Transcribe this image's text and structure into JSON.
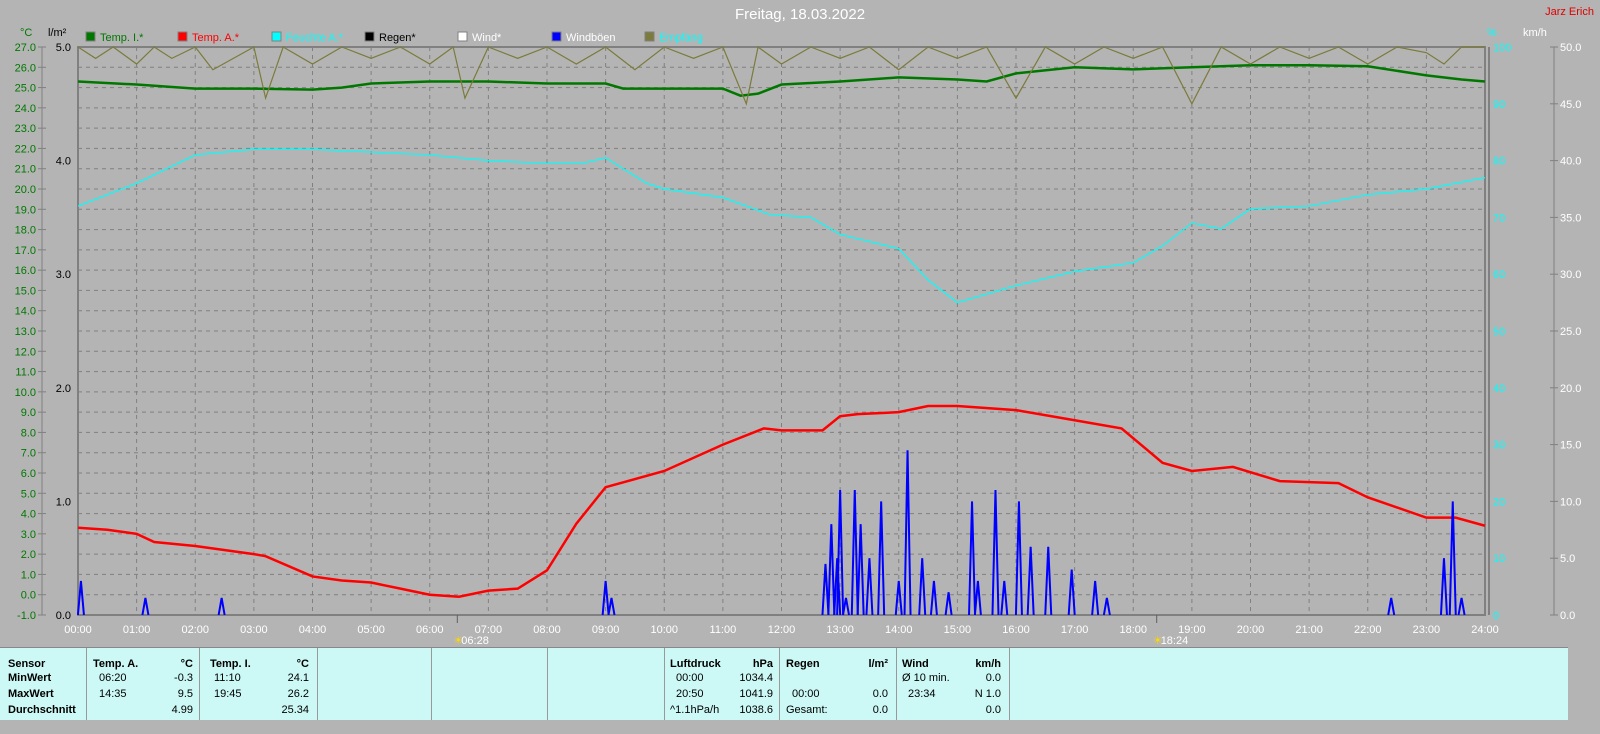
{
  "header": {
    "title": "Freitag, 18.03.2022",
    "author": "Jarz Erich"
  },
  "chart_data": {
    "type": "line",
    "title": "Freitag, 18.03.2022",
    "legend_placement": "top",
    "legend": [
      {
        "label": "Temp. I.*",
        "color": "#007800",
        "text_color": "#007800"
      },
      {
        "label": "Temp. A.*",
        "color": "#ff0000",
        "text_color": "#ff0000"
      },
      {
        "label": "Feuchte A.*",
        "color": "#00ffff",
        "text_color": "#00ffff"
      },
      {
        "label": "Regen*",
        "color": "#000000",
        "text_color": "#000000"
      },
      {
        "label": "Wind*",
        "color": "#ffffff",
        "text_color": "#ffffff"
      },
      {
        "label": "Windböen",
        "color": "#0000ff",
        "text_color": "#ffffff"
      },
      {
        "label": "Empfang",
        "color": "#7b7b3b",
        "text_color": "#00ffff"
      }
    ],
    "axes": {
      "temp": {
        "unit": "°C",
        "range": [
          -1.0,
          27.0
        ],
        "ticks": [
          "27.0",
          "26.0",
          "25.0",
          "24.0",
          "23.0",
          "22.0",
          "21.0",
          "20.0",
          "19.0",
          "18.0",
          "17.0",
          "16.0",
          "15.0",
          "14.0",
          "13.0",
          "12.0",
          "11.0",
          "10.0",
          "9.0",
          "8.0",
          "7.0",
          "6.0",
          "5.0",
          "4.0",
          "3.0",
          "2.0",
          "1.0",
          "0.0",
          "-1.0"
        ],
        "color": "#007800"
      },
      "rain": {
        "unit": "l/m²",
        "range": [
          0,
          5
        ],
        "ticks": [
          "5.0",
          "4.0",
          "3.0",
          "2.0",
          "1.0",
          "0.0"
        ],
        "color": "#000000"
      },
      "humidity": {
        "unit": "%",
        "range": [
          0,
          100
        ],
        "ticks": [
          "100",
          "90",
          "80",
          "70",
          "60",
          "50",
          "40",
          "30",
          "20",
          "10",
          "0"
        ],
        "color": "#00ffff"
      },
      "wind": {
        "unit": "km/h",
        "range": [
          0,
          50
        ],
        "ticks": [
          "50.0",
          "45.0",
          "40.0",
          "35.0",
          "30.0",
          "25.0",
          "20.0",
          "15.0",
          "10.0",
          "5.0",
          "0.0"
        ],
        "color": "#ffffff"
      },
      "x": {
        "range": [
          0,
          24
        ],
        "ticks": [
          "00:00",
          "01:00",
          "02:00",
          "03:00",
          "04:00",
          "05:00",
          "06:00",
          "07:00",
          "08:00",
          "09:00",
          "10:00",
          "11:00",
          "12:00",
          "13:00",
          "14:00",
          "15:00",
          "16:00",
          "17:00",
          "18:00",
          "19:00",
          "20:00",
          "21:00",
          "22:00",
          "23:00",
          "24:00"
        ]
      }
    },
    "sunrise": {
      "hour": 6.47,
      "label": "06:28"
    },
    "sunset": {
      "hour": 18.4,
      "label": "18:24"
    },
    "series": [
      {
        "name": "Temp. I.",
        "axis": "temp",
        "color": "#007800",
        "x": [
          0,
          1,
          2,
          3,
          4,
          4.5,
          5,
          6,
          7,
          8,
          9,
          9.3,
          10,
          11,
          11.3,
          11.6,
          12,
          13,
          14,
          15,
          15.5,
          16,
          17,
          18,
          19,
          20,
          21,
          22,
          23,
          23.6,
          24
        ],
        "y": [
          25.3,
          25.15,
          24.95,
          24.95,
          24.9,
          25.0,
          25.2,
          25.3,
          25.3,
          25.2,
          25.2,
          24.95,
          24.95,
          24.95,
          24.6,
          24.7,
          25.15,
          25.3,
          25.5,
          25.4,
          25.3,
          25.7,
          26.0,
          25.9,
          26.0,
          26.1,
          26.1,
          26.05,
          25.6,
          25.4,
          25.3
        ]
      },
      {
        "name": "Temp. A.",
        "axis": "temp",
        "color": "#ff0000",
        "x": [
          0,
          0.5,
          1,
          1.3,
          2,
          3,
          3.2,
          4,
          4.5,
          5,
          5.5,
          6,
          6.5,
          7,
          7.5,
          8,
          8.5,
          9,
          10,
          11,
          11.7,
          12,
          12.7,
          13,
          13.3,
          14,
          14.5,
          15,
          16,
          17,
          17.8,
          18.5,
          19,
          19.7,
          20.5,
          21.5,
          22,
          23,
          23.5,
          24
        ],
        "y": [
          3.3,
          3.2,
          3.0,
          2.6,
          2.4,
          2.0,
          1.9,
          0.9,
          0.7,
          0.6,
          0.3,
          0.0,
          -0.1,
          0.2,
          0.3,
          1.2,
          3.5,
          5.3,
          6.1,
          7.4,
          8.2,
          8.1,
          8.1,
          8.8,
          8.9,
          9.0,
          9.3,
          9.3,
          9.1,
          8.6,
          8.2,
          6.5,
          6.1,
          6.3,
          5.6,
          5.5,
          4.8,
          3.8,
          3.8,
          3.4
        ]
      },
      {
        "name": "Feuchte A.",
        "axis": "humidity",
        "color": "#00ffff",
        "x": [
          0,
          1,
          2,
          3,
          4,
          5,
          6,
          7,
          8,
          8.6,
          9,
          9.7,
          10,
          11,
          11.8,
          12.5,
          13,
          14,
          14.5,
          15,
          16,
          17,
          18,
          18.5,
          19,
          19.5,
          20,
          21,
          22,
          23,
          24
        ],
        "y": [
          72,
          76,
          81,
          82,
          82,
          81.5,
          81,
          80,
          79.5,
          79.5,
          80.5,
          76,
          75,
          73.5,
          70.5,
          70,
          67,
          64.5,
          59,
          55,
          58,
          60.5,
          62,
          65,
          69,
          68,
          71.5,
          72,
          74,
          75,
          77
        ]
      },
      {
        "name": "Empfang",
        "axis": "humidity",
        "color": "#7b7b3b",
        "x": [
          0,
          0.3,
          0.6,
          1,
          1.3,
          1.6,
          2,
          2.3,
          3,
          3.2,
          3.5,
          4,
          4.5,
          5,
          5.5,
          6,
          6.4,
          6.6,
          7,
          7.5,
          8,
          8.5,
          9,
          9.5,
          10,
          10.5,
          11,
          11.4,
          11.6,
          12,
          12.5,
          13,
          13.5,
          14,
          14.5,
          15,
          15.5,
          16,
          16.5,
          17,
          17.5,
          18,
          18.5,
          19,
          19.5,
          20,
          20.5,
          21,
          21.5,
          22,
          22.5,
          23,
          23.3,
          23.6,
          24
        ],
        "y": [
          100,
          98,
          100,
          97,
          100,
          98,
          100,
          96,
          100,
          91,
          100,
          97,
          100,
          98,
          100,
          97,
          100,
          91,
          100,
          98,
          100,
          97,
          100,
          96,
          100,
          98,
          100,
          90,
          100,
          97,
          100,
          98,
          100,
          96,
          100,
          98,
          100,
          91,
          100,
          97,
          100,
          98,
          100,
          90,
          100,
          97,
          100,
          98,
          100,
          97,
          100,
          99,
          97,
          100,
          100
        ]
      },
      {
        "name": "Windböen",
        "axis": "wind",
        "color": "#0000ff",
        "type": "spikes",
        "x": [
          0.05,
          1.15,
          2.45,
          9.0,
          9.1,
          12.75,
          12.85,
          12.95,
          13.0,
          13.1,
          13.25,
          13.35,
          13.5,
          13.7,
          14.0,
          14.15,
          14.4,
          14.6,
          14.85,
          15.25,
          15.35,
          15.65,
          15.8,
          16.05,
          16.25,
          16.55,
          16.95,
          17.35,
          17.55,
          22.4,
          23.3,
          23.45,
          23.6
        ],
        "y": [
          3,
          1.5,
          1.5,
          3,
          1.5,
          4.5,
          8,
          5,
          11,
          1.5,
          11,
          8,
          5,
          10,
          3,
          14.5,
          5,
          3,
          2,
          10,
          3,
          11,
          3,
          10,
          6,
          6,
          4,
          3,
          1.5,
          1.5,
          5,
          10,
          1.5
        ]
      }
    ]
  },
  "table": {
    "sensor": {
      "header": "Sensor",
      "rows": [
        "MinWert",
        "MaxWert",
        "Durchschnitt"
      ]
    },
    "temp_a": {
      "header": "Temp. A.",
      "unit": "°C",
      "min_time": "06:20",
      "min": "-0.3",
      "max_time": "14:35",
      "max": "9.5",
      "avg": "4.99"
    },
    "temp_i": {
      "header": "Temp. I.",
      "unit": "°C",
      "min_time": "11:10",
      "min": "24.1",
      "max_time": "19:45",
      "max": "26.2",
      "avg": "25.34"
    },
    "pressure": {
      "header": "Luftdruck",
      "unit": "hPa",
      "min_time": "00:00",
      "min": "1034.4",
      "max_time": "20:50",
      "max": "1041.9",
      "trend": "^1.1hPa/h",
      "avg": "1038.6"
    },
    "rain": {
      "header": "Regen",
      "unit": "l/m²",
      "time": "00:00",
      "value": "0.0",
      "total_label": "Gesamt:",
      "total": "0.0"
    },
    "wind": {
      "header": "Wind",
      "unit": "km/h",
      "avg_label": "Ø 10 min.",
      "avg": "0.0",
      "max_time": "23:34",
      "max": "N 1.0",
      "daily": "0.0"
    }
  }
}
